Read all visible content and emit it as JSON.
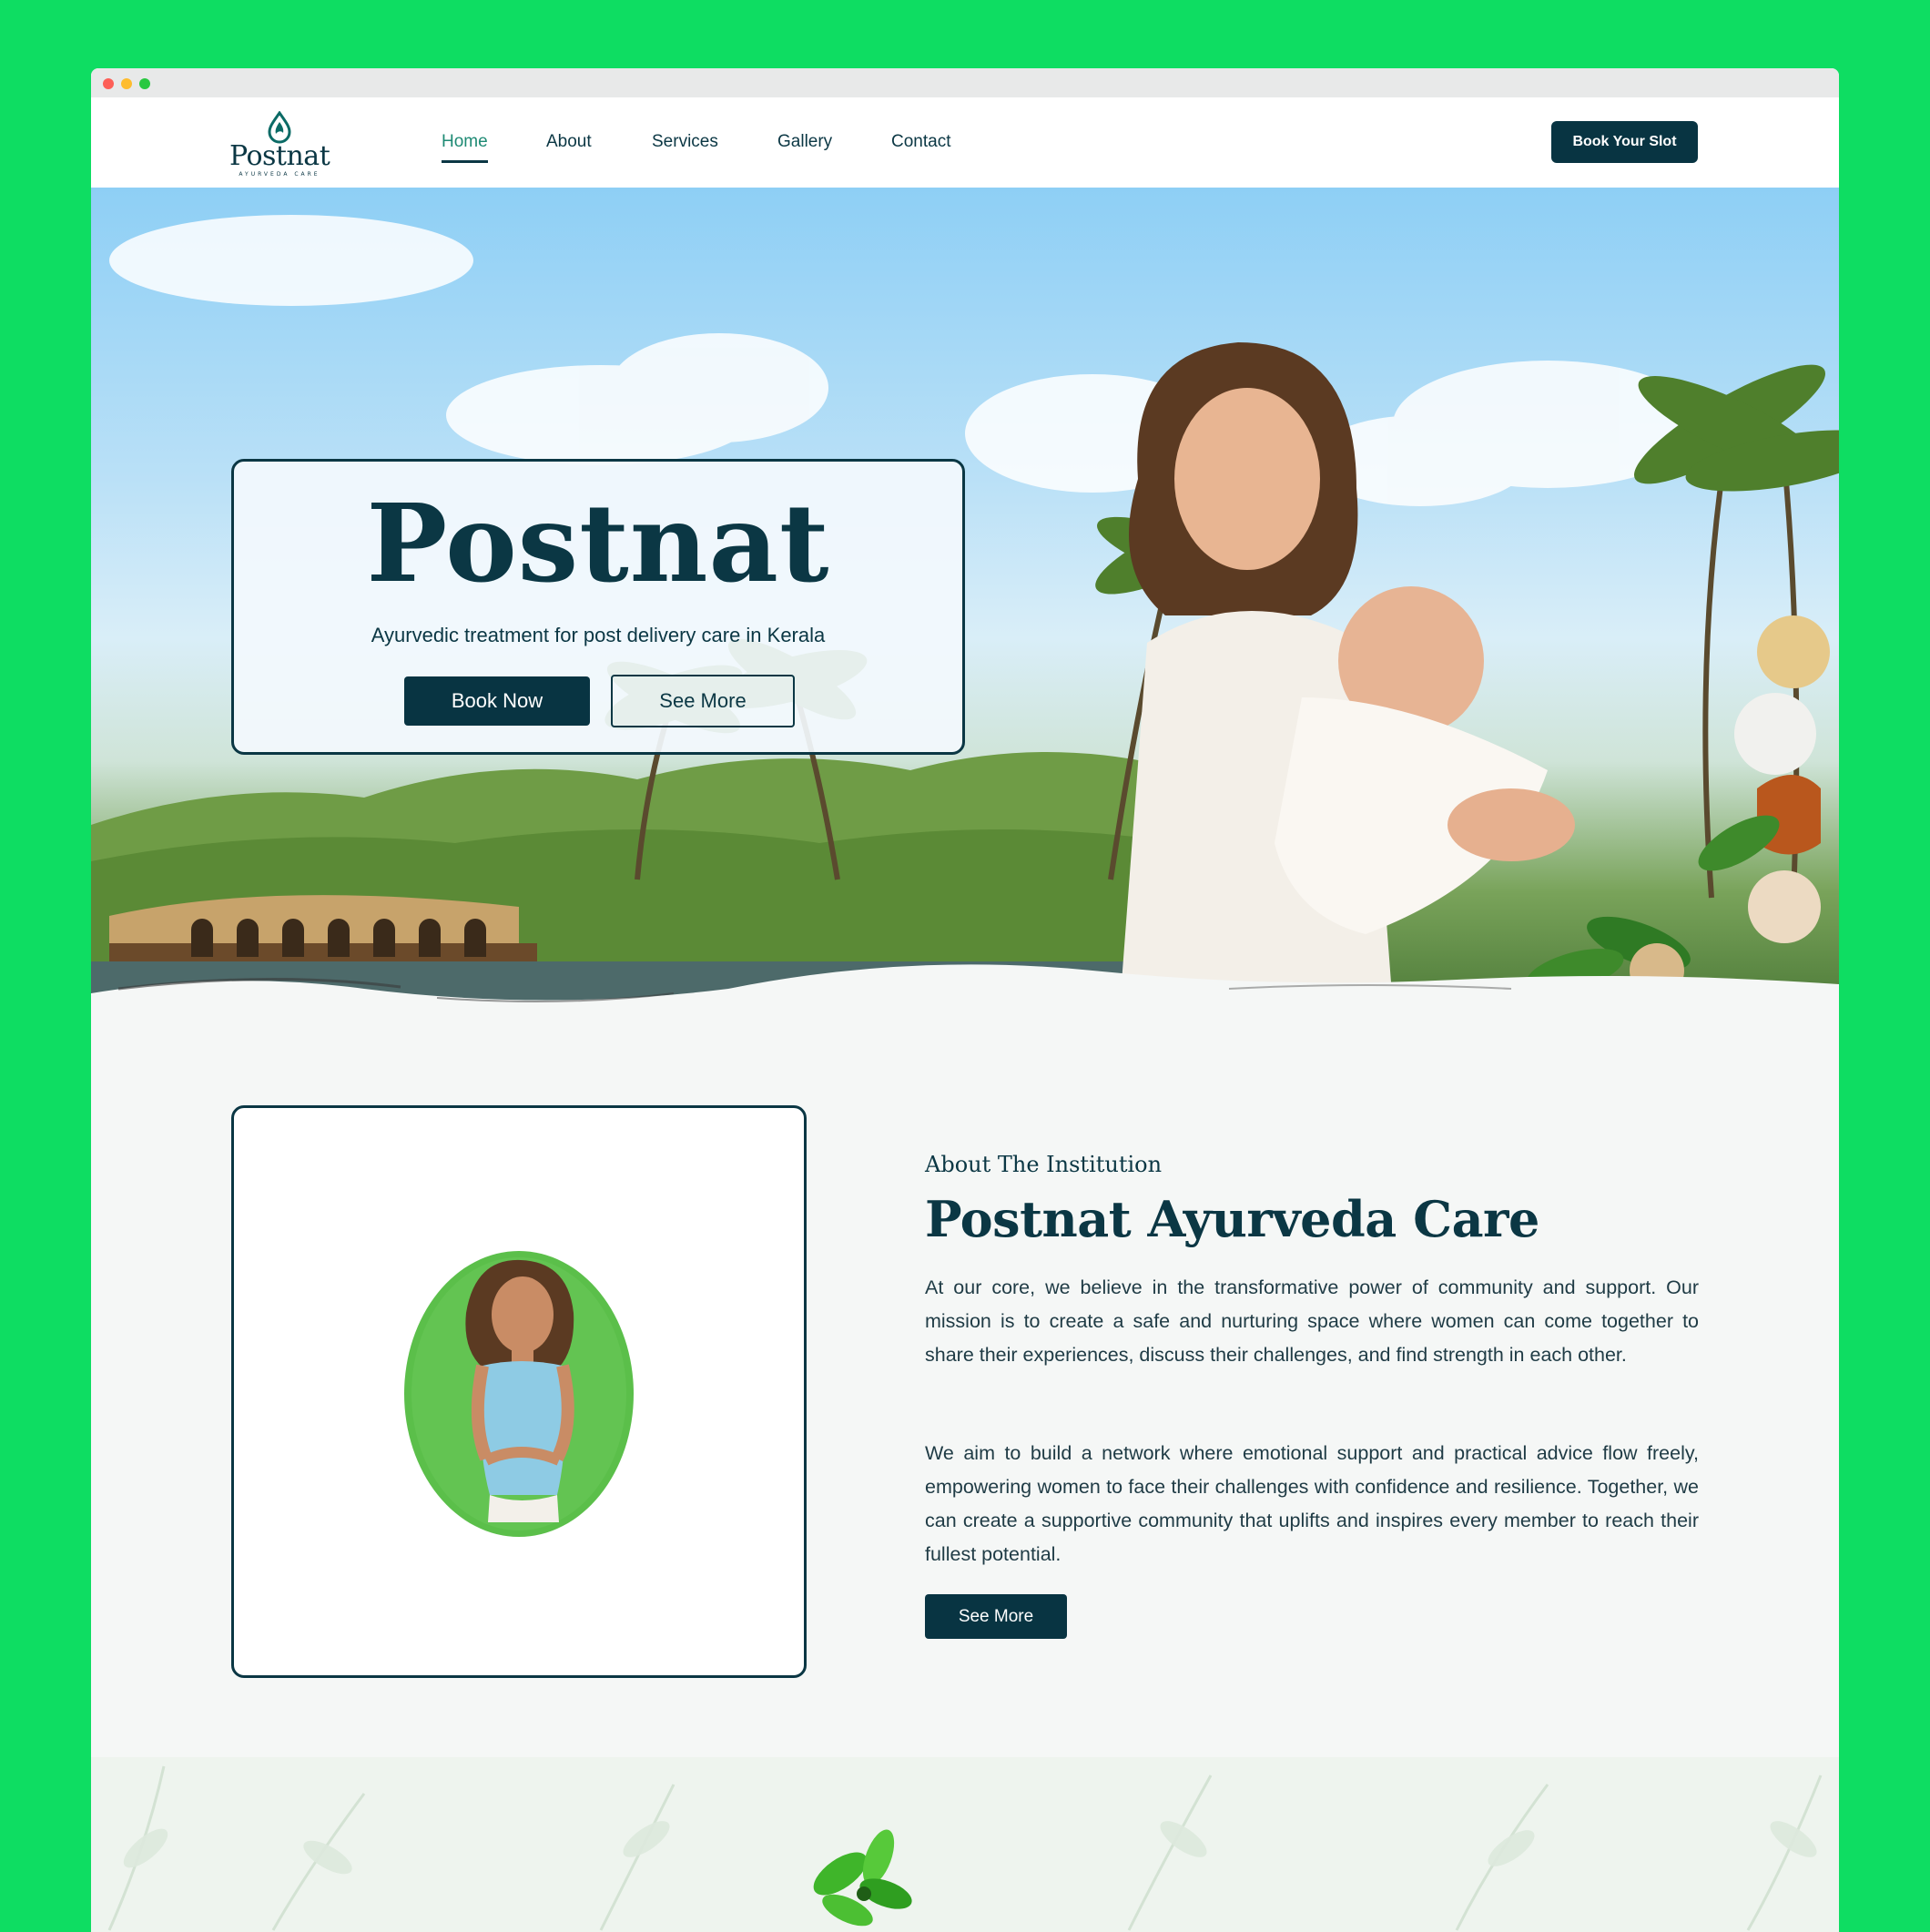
{
  "window": {
    "controls": [
      "close",
      "minimize",
      "maximize"
    ]
  },
  "header": {
    "logo": {
      "name": "Postnat",
      "tagline": "AYURVEDA CARE",
      "icon": "drop-logo-icon"
    },
    "nav": [
      {
        "label": "Home",
        "active": true
      },
      {
        "label": "About",
        "active": false
      },
      {
        "label": "Services",
        "active": false
      },
      {
        "label": "Gallery",
        "active": false
      },
      {
        "label": "Contact",
        "active": false
      }
    ],
    "cta_label": "Book Your Slot"
  },
  "hero": {
    "title": "Postnat",
    "subtitle": "Ayurvedic treatment for post delivery care in Kerala",
    "primary_button": "Book Now",
    "secondary_button": "See More",
    "image": "mother-holding-baby-with-kerala-backwaters"
  },
  "about": {
    "kicker": "About The Institution",
    "title": "Postnat Ayurveda Care",
    "paragraphs": [
      "At our core, we believe in the transformative power of community and support. Our mission is to create a safe and nurturing space where women can come together to share their experiences, discuss their challenges, and find strength in each other.",
      "We aim to build a network where emotional support and practical advice flow freely, empowering women to face their challenges with confidence and resilience. Together, we can create a supportive community that uplifts and inspires every member to reach their fullest potential."
    ],
    "button": "See More",
    "image": "pregnant-woman-oval-portrait"
  },
  "colors": {
    "brand_dark": "#0b3744",
    "button_bg": "#083442",
    "active_nav": "#1e8a74",
    "page_bg": "#0edd62",
    "oval_green": "#5bbf4a"
  }
}
